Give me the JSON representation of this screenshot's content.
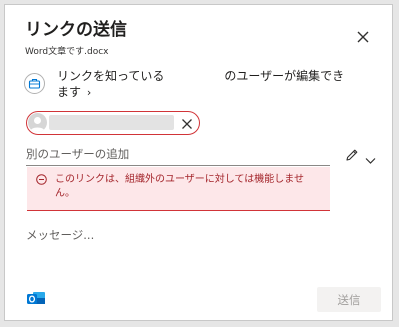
{
  "dialog": {
    "title": "リンクの送信",
    "filename": "Word文章です.docx",
    "close_icon": "close-icon"
  },
  "permission": {
    "icon": "briefcase-icon",
    "text_part1": "リンクを知っている",
    "text_part2": "のユーザーが編集でき",
    "text_line2": "ます",
    "chevron": "›"
  },
  "recipient": {
    "avatar_icon": "person-icon",
    "remove_icon": "close-icon"
  },
  "add_people": {
    "placeholder": "別のユーザーの追加",
    "edit_icon": "pencil-icon",
    "dropdown_icon": "chevron-down-icon"
  },
  "error": {
    "icon": "minus-circle-icon",
    "text": "このリンクは、組織外のユーザーに対しては機能しません。",
    "color": "#a4262c",
    "background": "#fde7e9"
  },
  "message": {
    "placeholder": "メッセージ..."
  },
  "footer": {
    "outlook_icon": "outlook-icon",
    "send_label": "送信"
  },
  "colors": {
    "accent_error": "#d13438",
    "outlook_blue": "#0364b8"
  }
}
